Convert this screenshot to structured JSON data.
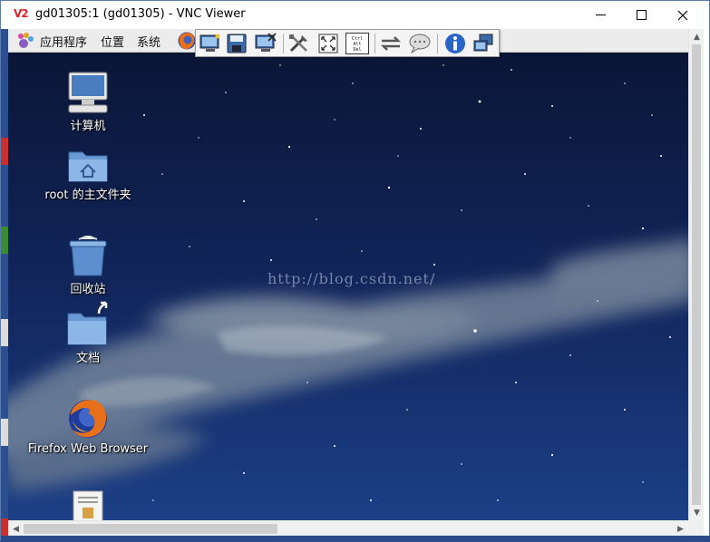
{
  "window": {
    "title": "gd01305:1 (gd01305) - VNC Viewer",
    "app_logo": "V2",
    "controls": {
      "minimize_icon": "minimize-icon",
      "maximize_icon": "maximize-icon",
      "close_icon": "close-icon"
    }
  },
  "panel": {
    "menus": [
      "应用程序",
      "位置",
      "系统"
    ],
    "launcher_icon": "firefox-icon"
  },
  "toolbar": {
    "buttons": [
      "new-connection-icon",
      "save-icon",
      "close-connection-icon",
      "options-icon",
      "fullscreen-icon",
      "ctrl-alt-del-icon",
      "transfer-icon",
      "chat-icon",
      "info-icon",
      "refresh-icon"
    ],
    "cad_text": [
      "Ctrl",
      "Alt",
      "Del"
    ]
  },
  "desktop": {
    "icons": [
      {
        "label": "计算机",
        "icon": "computer-icon"
      },
      {
        "label": "root 的主文件夹",
        "icon": "home-folder-icon"
      },
      {
        "label": "回收站",
        "icon": "trash-icon"
      },
      {
        "label": "文档",
        "icon": "documents-folder-icon"
      },
      {
        "label": "Firefox Web Browser",
        "icon": "firefox-icon"
      },
      {
        "label": "",
        "icon": "document-icon"
      }
    ],
    "watermark": "http://blog.csdn.net/"
  },
  "colors": {
    "sky": "#0b1840",
    "panel": "#ececec",
    "accent": "#d4282d"
  }
}
